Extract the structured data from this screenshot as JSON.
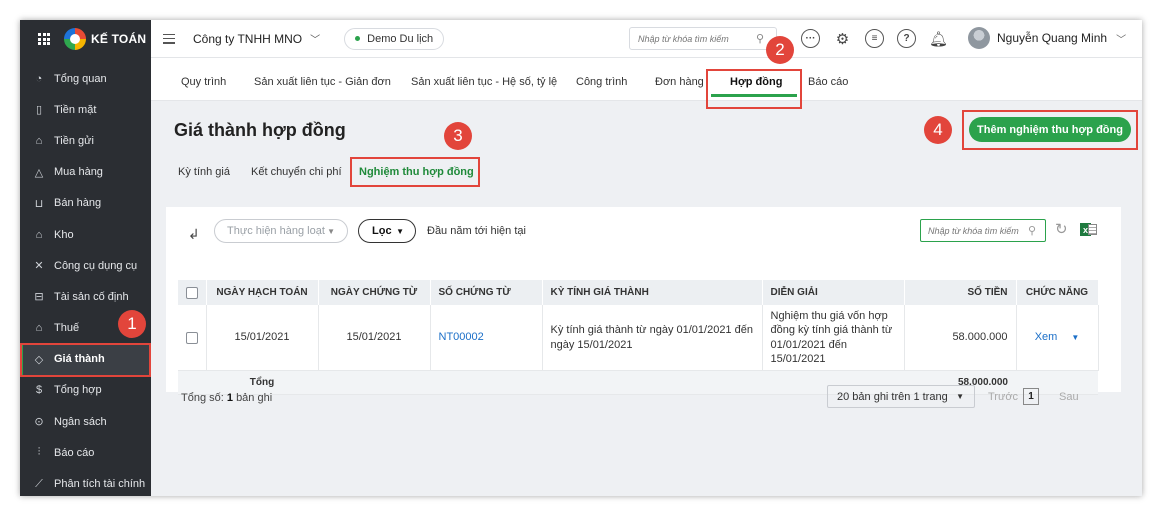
{
  "brand": {
    "name": "KẾ TOÁN"
  },
  "sidebar": {
    "items": [
      {
        "label": "Tổng quan",
        "icon": "gauge-icon"
      },
      {
        "label": "Tiền mặt",
        "icon": "wallet-icon"
      },
      {
        "label": "Tiền gửi",
        "icon": "bank-icon"
      },
      {
        "label": "Mua hàng",
        "icon": "shopping-bag-icon"
      },
      {
        "label": "Bán hàng",
        "icon": "cart-icon"
      },
      {
        "label": "Kho",
        "icon": "warehouse-icon"
      },
      {
        "label": "Công cụ dụng cụ",
        "icon": "tools-icon"
      },
      {
        "label": "Tài sản cố định",
        "icon": "car-icon"
      },
      {
        "label": "Thuế",
        "icon": "building-icon"
      },
      {
        "label": "Giá thành",
        "icon": "tag-icon",
        "active": true
      },
      {
        "label": "Tổng hợp",
        "icon": "dollar-doc-icon"
      },
      {
        "label": "Ngân sách",
        "icon": "budget-icon"
      },
      {
        "label": "Báo cáo",
        "icon": "bar-chart-icon"
      },
      {
        "label": "Phân tích tài chính",
        "icon": "line-chart-icon"
      }
    ]
  },
  "topbar": {
    "company": "Công ty TNHH MNO",
    "demo": "Demo Du lịch",
    "search_placeholder": "Nhập từ khóa tìm kiếm",
    "user_name": "Nguyễn Quang Minh"
  },
  "tabs": [
    "Quy trình",
    "Sản xuất liên tục - Giản đơn",
    "Sản xuất liên tục - Hệ số, tỷ lệ",
    "Công trình",
    "Đơn hàng",
    "Hợp đồng",
    "Báo cáo"
  ],
  "page": {
    "title": "Giá thành hợp đồng",
    "add_button": "Thêm nghiệm thu hợp đồng",
    "subtabs": [
      "Kỳ tính giá",
      "Kết chuyển chi phí",
      "Nghiệm thu hợp đồng"
    ]
  },
  "annotations": [
    "1",
    "2",
    "3",
    "4"
  ],
  "toolbar": {
    "batch": "Thực hiện hàng loạt",
    "filter": "Lọc",
    "period": "Đầu năm tới hiện tại",
    "search_placeholder": "Nhập từ khóa tìm kiếm"
  },
  "table": {
    "headers": [
      "NGÀY HẠCH TOÁN",
      "NGÀY CHỨNG TỪ",
      "SỐ CHỨNG TỪ",
      "KỲ TÍNH GIÁ THÀNH",
      "DIỄN GIẢI",
      "SỐ TIỀN",
      "CHỨC NĂNG"
    ],
    "rows": [
      {
        "posting_date": "15/01/2021",
        "doc_date": "15/01/2021",
        "doc_no": "NT00002",
        "period": "Kỳ tính giá thành từ ngày 01/01/2021 đến ngày 15/01/2021",
        "description": "Nghiệm thu giá vốn hợp đồng kỳ tính giá thành từ 01/01/2021 đến 15/01/2021",
        "amount": "58.000.000",
        "action": "Xem"
      }
    ],
    "total_label": "Tổng",
    "total_amount": "58.000.000"
  },
  "footer": {
    "count_prefix": "Tổng số:",
    "count": "1",
    "count_suffix": "bản ghi",
    "page_size": "20 bản ghi trên 1 trang",
    "prev": "Trước",
    "page": "1",
    "next": "Sau"
  },
  "colors": {
    "accent": "#2ba24c",
    "annotation": "#e2453b",
    "sidebar": "#2b2e33",
    "link": "#1b6fc8"
  }
}
